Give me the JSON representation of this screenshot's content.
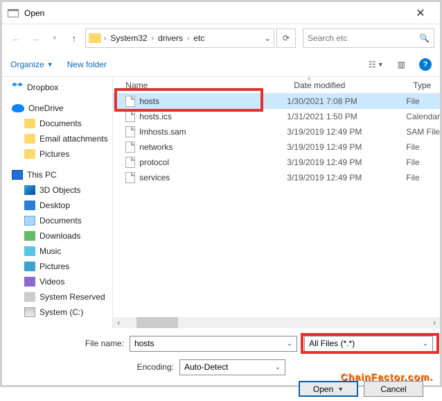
{
  "title": "Open",
  "breadcrumb": [
    "System32",
    "drivers",
    "etc"
  ],
  "search_placeholder": "Search etc",
  "toolbar": {
    "organize": "Organize",
    "new_folder": "New folder"
  },
  "tree": {
    "dropbox": "Dropbox",
    "onedrive": "OneDrive",
    "od_children": [
      "Documents",
      "Email attachments",
      "Pictures"
    ],
    "thispc": "This PC",
    "pc_children": [
      "3D Objects",
      "Desktop",
      "Documents",
      "Downloads",
      "Music",
      "Pictures",
      "Videos",
      "System Reserved",
      "System (C:)"
    ]
  },
  "columns": {
    "name": "Name",
    "date": "Date modified",
    "type": "Type"
  },
  "files": [
    {
      "name": "hosts",
      "date": "1/30/2021 7:08 PM",
      "type": "File",
      "selected": true
    },
    {
      "name": "hosts.ics",
      "date": "1/31/2021 1:50 PM",
      "type": "Calendar",
      "selected": false
    },
    {
      "name": "lmhosts.sam",
      "date": "3/19/2019 12:49 PM",
      "type": "SAM File",
      "selected": false
    },
    {
      "name": "networks",
      "date": "3/19/2019 12:49 PM",
      "type": "File",
      "selected": false
    },
    {
      "name": "protocol",
      "date": "3/19/2019 12:49 PM",
      "type": "File",
      "selected": false
    },
    {
      "name": "services",
      "date": "3/19/2019 12:49 PM",
      "type": "File",
      "selected": false
    }
  ],
  "form": {
    "filename_label": "File name:",
    "filename_value": "hosts",
    "filter_value": "All Files  (*.*)",
    "encoding_label": "Encoding:",
    "encoding_value": "Auto-Detect",
    "open": "Open",
    "cancel": "Cancel"
  },
  "watermark": "ChainFactor.com."
}
